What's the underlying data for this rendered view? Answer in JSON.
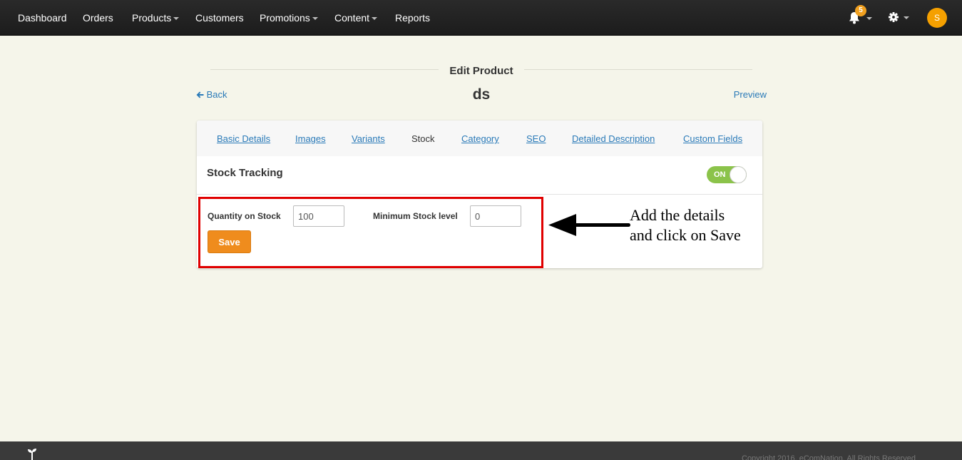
{
  "nav": {
    "items": [
      {
        "label": "Dashboard",
        "dropdown": false
      },
      {
        "label": "Orders",
        "dropdown": false
      },
      {
        "label": "Products",
        "dropdown": true
      },
      {
        "label": "Customers",
        "dropdown": false
      },
      {
        "label": "Promotions",
        "dropdown": true
      },
      {
        "label": "Content",
        "dropdown": true
      },
      {
        "label": "Reports",
        "dropdown": false
      }
    ],
    "notification_count": "5",
    "avatar_initial": "S"
  },
  "page": {
    "heading": "Edit Product",
    "back_label": "Back",
    "product_name": "ds",
    "preview_label": "Preview"
  },
  "tabs": [
    {
      "label": "Basic Details",
      "active": false
    },
    {
      "label": "Images",
      "active": false
    },
    {
      "label": "Variants",
      "active": false
    },
    {
      "label": "Stock",
      "active": true
    },
    {
      "label": "Category",
      "active": false
    },
    {
      "label": "SEO",
      "active": false
    },
    {
      "label": "Detailed Description",
      "active": false
    },
    {
      "label": "Custom Fields",
      "active": false
    }
  ],
  "stock": {
    "tracking_label": "Stock Tracking",
    "toggle_label": "ON",
    "quantity_label": "Quantity on Stock",
    "quantity_value": "100",
    "min_level_label": "Minimum Stock level",
    "min_level_value": "0",
    "save_label": "Save"
  },
  "annotation": {
    "line1": "Add the details",
    "line2": "and click on Save"
  },
  "footer": {
    "copyright": "Copyright 2016, eComNation. All Rights Reserved"
  },
  "colors": {
    "accent_orange": "#ef8c1d",
    "toggle_green": "#8bc34a",
    "link_blue": "#2a7ab8",
    "highlight_red": "#e00000",
    "navbar": "#1f1f1f",
    "page_bg": "#f5f5ea"
  }
}
